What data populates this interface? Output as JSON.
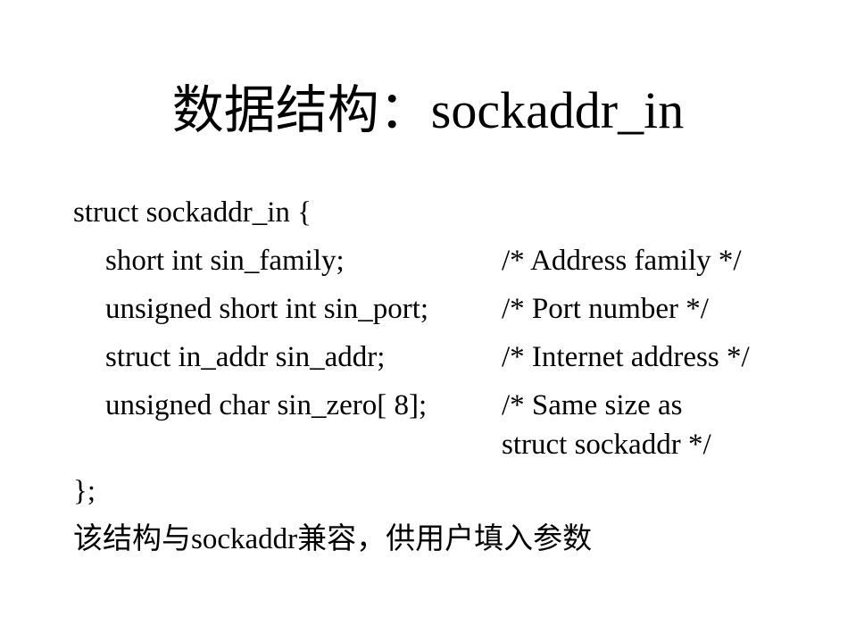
{
  "slide": {
    "title": "数据结构：sockaddr_in",
    "struct_open": "struct sockaddr_in {",
    "fields": [
      {
        "code": "short int sin_family;",
        "comment": "/* Address family */"
      },
      {
        "code": "unsigned short int sin_port;",
        "comment": "/* Port number */"
      },
      {
        "code": "struct in_addr sin_addr;",
        "comment": "/* Internet address */"
      },
      {
        "code": "unsigned char sin_zero[ 8];",
        "comment": "/* Same size as",
        "comment_cont": "struct  sockaddr */"
      }
    ],
    "struct_close": "};",
    "note": "该结构与sockaddr兼容，供用户填入参数"
  }
}
